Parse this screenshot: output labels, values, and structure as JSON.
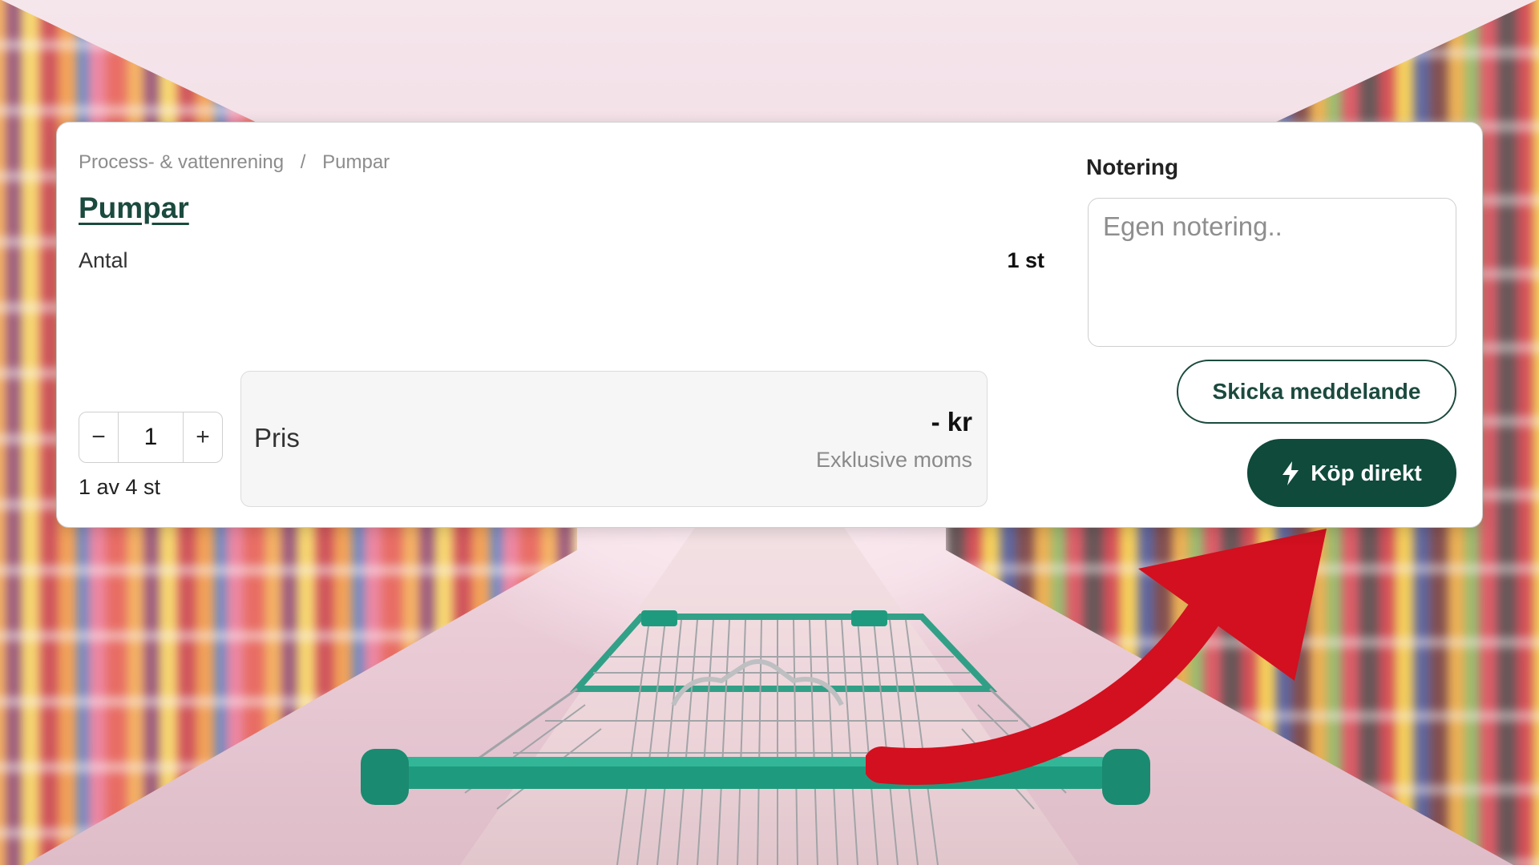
{
  "breadcrumb": {
    "category": "Process- & vattenrening",
    "separator": "/",
    "current": "Pumpar"
  },
  "product": {
    "title": "Pumpar"
  },
  "quantity_info": {
    "label": "Antal",
    "value": "1 st"
  },
  "stepper": {
    "minus": "−",
    "value": "1",
    "plus": "+"
  },
  "stock": {
    "text": "1 av 4 st"
  },
  "price": {
    "label": "Pris",
    "value": "- kr",
    "note": "Exklusive moms"
  },
  "note": {
    "label": "Notering",
    "placeholder": "Egen notering.."
  },
  "actions": {
    "send_label": "Skicka meddelande",
    "buy_label": "Köp direkt",
    "buy_icon": "lightning-bolt-icon"
  },
  "colors": {
    "brand_green": "#0f4a3b",
    "arrow_red": "#d2101f",
    "basket_teal": "#1e9b7e"
  }
}
